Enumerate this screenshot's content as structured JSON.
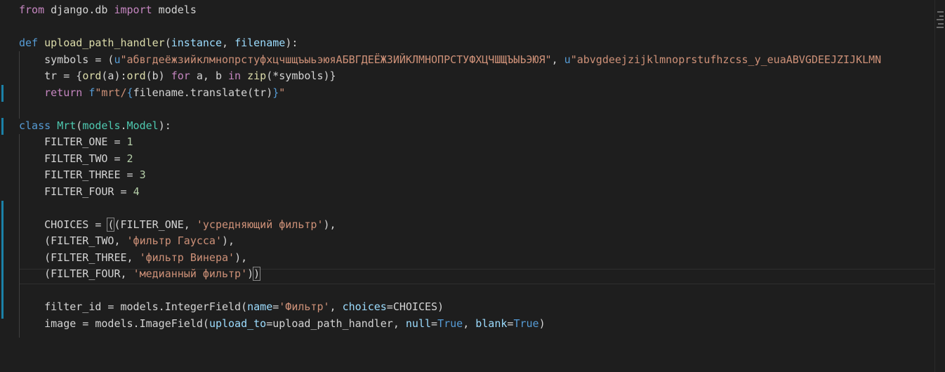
{
  "editor": {
    "theme": {
      "background": "#1e1e1e",
      "git_modified": "#1b81a8"
    },
    "lines": [
      [
        [
          "kw",
          "from"
        ],
        [
          "txt",
          " django.db "
        ],
        [
          "kw",
          "import"
        ],
        [
          "txt",
          " models"
        ]
      ],
      [],
      [
        [
          "def",
          "def"
        ],
        [
          "txt",
          " "
        ],
        [
          "fn",
          "upload_path_handler"
        ],
        [
          "txt",
          "("
        ],
        [
          "param",
          "instance"
        ],
        [
          "txt",
          ", "
        ],
        [
          "param",
          "filename"
        ],
        [
          "txt",
          "):"
        ]
      ],
      [
        [
          "txt",
          "    symbols = ("
        ],
        [
          "def",
          "u"
        ],
        [
          "str",
          "\"абвгдеёжзийклмнопрстуфхцчшщъыьэюяАБВГДЕЁЖЗИЙКЛМНОПРСТУФХЦЧШЩЪЫЬЭЮЯ\""
        ],
        [
          "txt",
          ", "
        ],
        [
          "def",
          "u"
        ],
        [
          "str",
          "\"abvgdeejzijklmnoprstufhzcss_y_euaABVGDEEJZIJKLMN"
        ]
      ],
      [
        [
          "txt",
          "    tr = {"
        ],
        [
          "fn",
          "ord"
        ],
        [
          "txt",
          "(a):"
        ],
        [
          "fn",
          "ord"
        ],
        [
          "txt",
          "(b) "
        ],
        [
          "kw",
          "for"
        ],
        [
          "txt",
          " a, b "
        ],
        [
          "kw",
          "in"
        ],
        [
          "txt",
          " "
        ],
        [
          "fn",
          "zip"
        ],
        [
          "txt",
          "(*symbols)}"
        ]
      ],
      [
        [
          "txt",
          "    "
        ],
        [
          "kw",
          "return"
        ],
        [
          "txt",
          " "
        ],
        [
          "def",
          "f"
        ],
        [
          "str",
          "\"mrt/"
        ],
        [
          "def",
          "{"
        ],
        [
          "txt",
          "filename.translate(tr)"
        ],
        [
          "def",
          "}"
        ],
        [
          "str",
          "\""
        ]
      ],
      [],
      [
        [
          "def",
          "class"
        ],
        [
          "txt",
          " "
        ],
        [
          "cls",
          "Mrt"
        ],
        [
          "txt",
          "("
        ],
        [
          "cls",
          "models"
        ],
        [
          "txt",
          "."
        ],
        [
          "cls",
          "Model"
        ],
        [
          "txt",
          "):"
        ]
      ],
      [
        [
          "txt",
          "    FILTER_ONE = "
        ],
        [
          "num",
          "1"
        ]
      ],
      [
        [
          "txt",
          "    FILTER_TWO = "
        ],
        [
          "num",
          "2"
        ]
      ],
      [
        [
          "txt",
          "    FILTER_THREE = "
        ],
        [
          "num",
          "3"
        ]
      ],
      [
        [
          "txt",
          "    FILTER_FOUR = "
        ],
        [
          "num",
          "4"
        ]
      ],
      [],
      [
        [
          "txt",
          "    CHOICES = "
        ],
        [
          "txt",
          "("
        ],
        [
          "txt",
          "(FILTER_ONE, "
        ],
        [
          "str",
          "'усредняющий фильтр'"
        ],
        [
          "txt",
          "),"
        ]
      ],
      [
        [
          "txt",
          "    (FILTER_TWO, "
        ],
        [
          "str",
          "'фильтр Гаусса'"
        ],
        [
          "txt",
          "),"
        ]
      ],
      [
        [
          "txt",
          "    (FILTER_THREE, "
        ],
        [
          "str",
          "'фильтр Винера'"
        ],
        [
          "txt",
          "),"
        ]
      ],
      [
        [
          "txt",
          "    (FILTER_FOUR, "
        ],
        [
          "str",
          "'медианный фильтр'"
        ],
        [
          "txt",
          ")"
        ],
        [
          "txt",
          ")"
        ]
      ],
      [],
      [
        [
          "txt",
          "    filter_id = models.IntegerField("
        ],
        [
          "param",
          "name"
        ],
        [
          "txt",
          "="
        ],
        [
          "str",
          "'Фильтр'"
        ],
        [
          "txt",
          ", "
        ],
        [
          "param",
          "choices"
        ],
        [
          "txt",
          "=CHOICES)"
        ]
      ],
      [
        [
          "txt",
          "    image = models.ImageField("
        ],
        [
          "param",
          "upload_to"
        ],
        [
          "txt",
          "=upload_path_handler, "
        ],
        [
          "param",
          "null"
        ],
        [
          "txt",
          "="
        ],
        [
          "bool",
          "True"
        ],
        [
          "txt",
          ", "
        ],
        [
          "param",
          "blank"
        ],
        [
          "txt",
          "="
        ],
        [
          "bool",
          "True"
        ],
        [
          "txt",
          ")"
        ]
      ]
    ]
  }
}
